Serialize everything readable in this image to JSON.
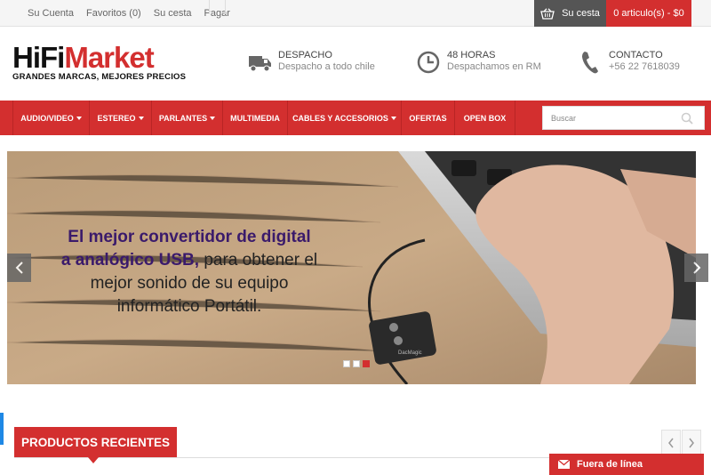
{
  "topbar": {
    "links": [
      "Su Cuenta",
      "Favoritos (0)",
      "Su cesta",
      "Pagar"
    ],
    "cart_label": "Su cesta",
    "cart_total": "0 articulo(s) - $0"
  },
  "logo": {
    "hifi": "HiFi",
    "market": "Market",
    "tagline": "GRANDES MARCAS, MEJORES PRECIOS"
  },
  "info": [
    {
      "title": "DESPACHO",
      "subtitle": "Despacho a todo chile",
      "icon": "truck-icon"
    },
    {
      "title": "48 HORAS",
      "subtitle": "Despachamos en RM",
      "icon": "clock-icon"
    },
    {
      "title": "CONTACTO",
      "subtitle": "+56 22 7618039",
      "icon": "phone-icon"
    }
  ],
  "nav": {
    "items": [
      {
        "label": "AUDIO/VIDEO",
        "dropdown": true
      },
      {
        "label": "ESTEREO",
        "dropdown": true
      },
      {
        "label": "PARLANTES",
        "dropdown": true
      },
      {
        "label": "MULTIMEDIA",
        "dropdown": false
      },
      {
        "label": "CABLES Y ACCESORIOS",
        "dropdown": true
      },
      {
        "label": "OFERTAS",
        "dropdown": false
      },
      {
        "label": "OPEN BOX",
        "dropdown": false
      }
    ],
    "search_placeholder": "Buscar"
  },
  "banner": {
    "line1_hl": "El mejor convertidor de digital",
    "line2_hl": "a analógico USB,",
    "line2_rest": " para obtener el",
    "line3": "mejor sonido de su equipo",
    "line4": "informático Portátil.",
    "device_label": "DacMagic",
    "slides": 3,
    "active_slide": 3
  },
  "section": {
    "title": "PRODUCTOS RECIENTES"
  },
  "chat": {
    "label": "Fuera de línea"
  },
  "colors": {
    "brand_red": "#d32f2f",
    "dark": "#555555",
    "banner_purple": "#3a1a6b"
  }
}
